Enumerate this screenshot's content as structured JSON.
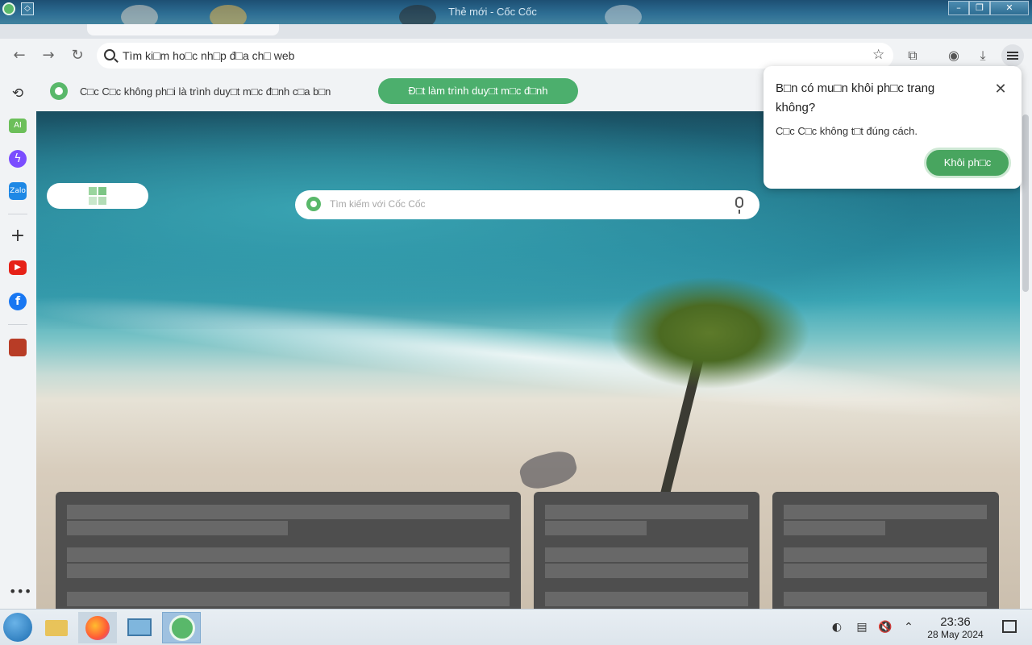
{
  "window": {
    "title": "Thẻ mới - Cốc Cốc",
    "pin_icon": "pin-icon",
    "controls": [
      "minimize",
      "maximize",
      "close"
    ]
  },
  "toolbar": {
    "address_placeholder": "Tìm ki□m ho□c nh□p đ□a ch□ web"
  },
  "infobar": {
    "message": "C□c C□c không ph□i là trình duy□t m□c đ□nh c□a b□n",
    "button": "Đ□t làm trình duy□t m□c đ□nh"
  },
  "newtab": {
    "search_placeholder": "Tìm kiếm với Cốc Cốc"
  },
  "popup": {
    "question": "B□n có mu□n khôi ph□c trang không?",
    "subtext": "C□c C□c không t□t đúng cách.",
    "button": "Khôi ph□c"
  },
  "sidebar": {
    "items": [
      "history-icon",
      "ai-icon",
      "messenger-icon",
      "zalo-icon",
      "add-icon",
      "youtube-icon",
      "facebook-icon",
      "game-icon",
      "more-icon"
    ]
  },
  "taskbar": {
    "time": "23:36",
    "date": "28 May 2024"
  },
  "colors": {
    "accent": "#4caf6d",
    "titlebar": "#2d6d93"
  }
}
